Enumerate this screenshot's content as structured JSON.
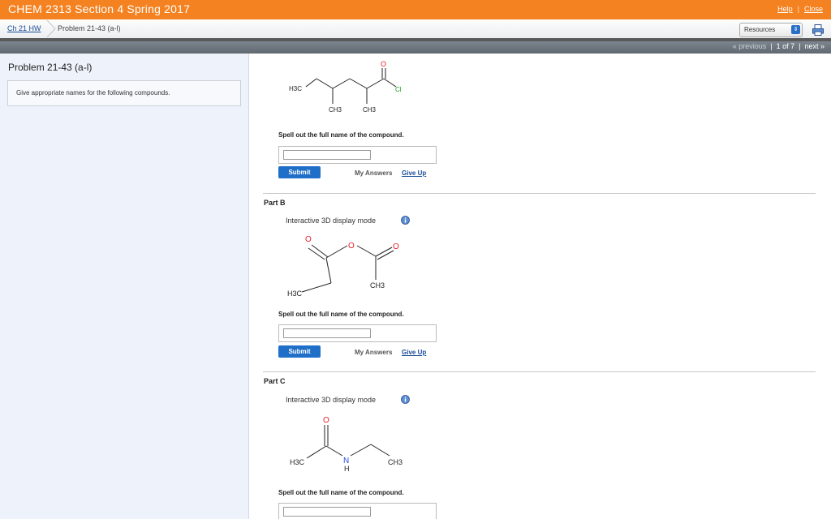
{
  "header": {
    "course_title": "CHEM 2313 Section 4 Spring 2017",
    "help_label": "Help",
    "close_label": "Close"
  },
  "breadcrumb": {
    "assignment": "Ch 21 HW",
    "problem": "Problem 21-43 (a-l)"
  },
  "toolbar": {
    "resources_label": "Resources"
  },
  "pager": {
    "previous_label": "« previous",
    "position": "1 of 7",
    "next_label": "next »"
  },
  "left_panel": {
    "title": "Problem 21-43 (a-l)",
    "instructions": "Give appropriate names for the following compounds."
  },
  "parts": [
    {
      "title": "",
      "prompt": "Spell out the full name of the compound.",
      "submit_label": "Submit",
      "my_answers_label": "My Answers",
      "give_up_label": "Give Up",
      "molecule_labels": {
        "h3c": "H3C",
        "ch3a": "CH3",
        "ch3b": "CH3",
        "o": "O",
        "cl": "Cl"
      }
    },
    {
      "title": "Part B",
      "mode_text": "Interactive 3D display mode",
      "prompt": "Spell out the full name of the compound.",
      "submit_label": "Submit",
      "my_answers_label": "My Answers",
      "give_up_label": "Give Up",
      "molecule_labels": {
        "h3c": "H3C",
        "ch3": "CH3",
        "o1": "O",
        "o2": "O",
        "o3": "O"
      }
    },
    {
      "title": "Part C",
      "mode_text": "Interactive 3D display mode",
      "prompt": "Spell out the full name of the compound.",
      "molecule_labels": {
        "h3c": "H3C",
        "ch3": "CH3",
        "o": "O",
        "n": "N",
        "h": "H"
      }
    }
  ],
  "colors": {
    "header_orange": "#f58220",
    "link_blue": "#1a4c97",
    "submit_blue": "#1f6fc9",
    "oxygen_red": "#e8202a",
    "nitrogen_blue": "#2a4fd8",
    "chlorine_green": "#1aa21a",
    "left_panel_bg": "#eef3fb"
  },
  "icons": {
    "printer": "printer-icon",
    "info": "info-icon",
    "select_arrows": "select-arrows-icon",
    "breadcrumb_arrow": "chevron-right-icon"
  }
}
